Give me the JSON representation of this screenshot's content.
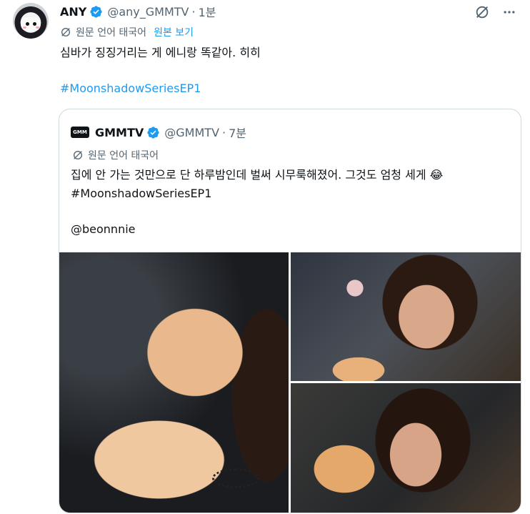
{
  "tweet": {
    "display_name": "ANY",
    "handle": "@any_GMMTV",
    "separator": "·",
    "time": "1분",
    "translation_note": "원문 언어 태국어",
    "show_original": "원본 보기",
    "text": "심바가 징징거리는 게 에니랑 똑같아. 히히",
    "hashtag": "#MoonshadowSeriesEP1"
  },
  "quoted": {
    "logo_text": "GMM",
    "display_name": "GMMTV",
    "handle": "@GMMTV",
    "separator": "·",
    "time": "7분",
    "translation_note": "원문 언어 태국어",
    "line1": "집에 안 가는 것만으로 단 하루밤인데 벌써 시무룩해졌어. 그것도 엄청 세게 😂",
    "line2": "#MoonshadowSeriesEP1",
    "mention": "@beonnnie"
  },
  "icons": {
    "verified": "verified-badge-icon",
    "grok": "grok-icon",
    "more": "more-icon",
    "translate": "translate-icon"
  },
  "colors": {
    "link": "#1d9bf0",
    "muted": "#536471",
    "text": "#0f1419",
    "border": "#cfd9de"
  }
}
